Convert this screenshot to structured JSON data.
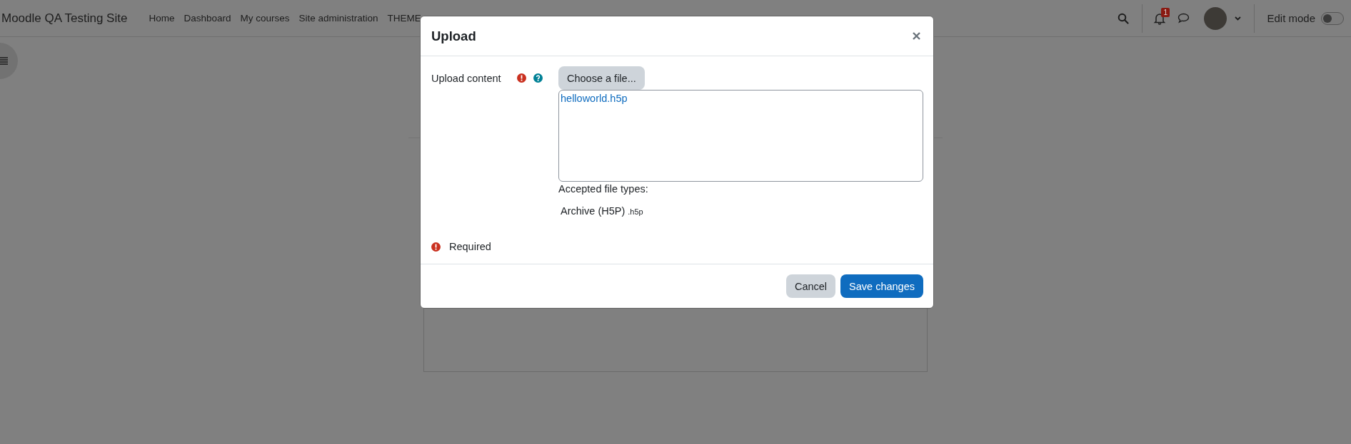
{
  "navbar": {
    "site_name": "Moodle QA Testing Site",
    "items": [
      {
        "label": "Home"
      },
      {
        "label": "Dashboard"
      },
      {
        "label": "My courses"
      },
      {
        "label": "Site administration"
      },
      {
        "label": "THEME"
      }
    ],
    "notification_count": "1",
    "edit_mode": {
      "label": "Edit mode",
      "on": false
    }
  },
  "dialog": {
    "title": "Upload",
    "field": {
      "label": "Upload content",
      "required": true,
      "help": true,
      "button": "Choose a file...",
      "files": [
        "helloworld.h5p"
      ],
      "accepted_label": "Accepted file types:",
      "types": [
        {
          "name": "Archive (H5P)",
          "ext": ".h5p"
        }
      ]
    },
    "required_note": "Required",
    "buttons": [
      {
        "label": "Cancel",
        "kind": "secondary"
      },
      {
        "label": "Save changes",
        "kind": "primary"
      }
    ]
  }
}
